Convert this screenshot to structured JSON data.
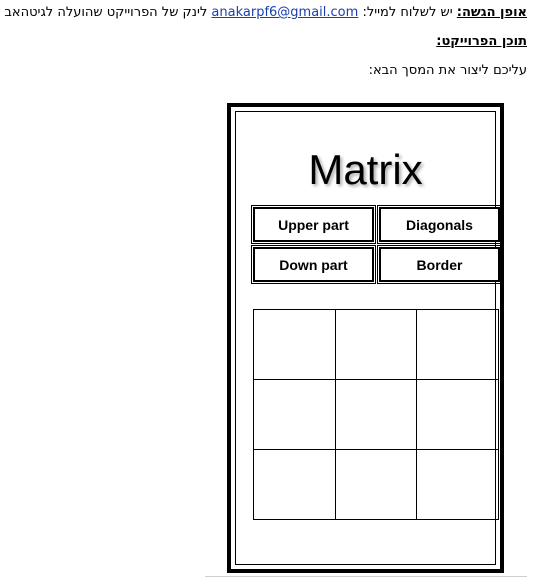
{
  "doc": {
    "submission_label": "אופן הגשה:",
    "submission_text_1": "יש לשלוח למייל:",
    "email": "anakarpf6@gmail.com",
    "submission_text_2": "לינק של הפרוייקט שהועלה לגיטהאב",
    "content_heading": "תוכן הפרוייקט:",
    "instruction": "עליכם ליצור את המסך הבא:"
  },
  "mockup": {
    "title": "Matrix",
    "buttons": {
      "upper": "Upper part",
      "diagonals": "Diagonals",
      "down": "Down part",
      "border": "Border"
    },
    "grid": {
      "rows": 3,
      "cols": 3
    }
  }
}
